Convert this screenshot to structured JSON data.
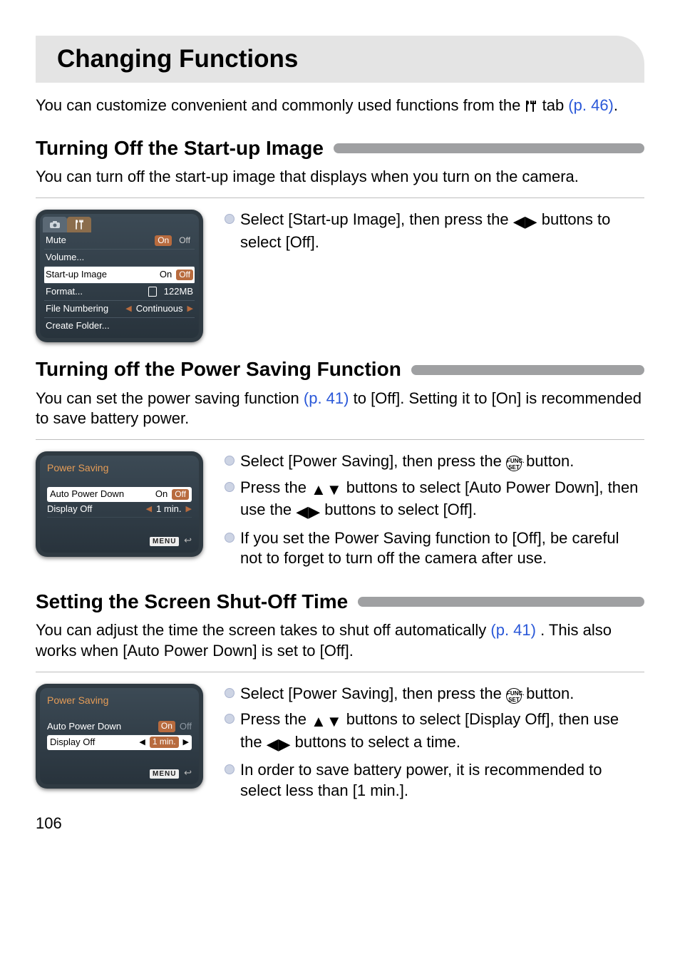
{
  "page_number": "106",
  "title": "Changing Functions",
  "intro": {
    "line1_pre": "You can customize convenient and commonly used functions from the ",
    "line1_post": " tab ",
    "ref1": "(p. 46)",
    "period": "."
  },
  "icons": {
    "tools": "tools-icon",
    "left_right": "◀▶",
    "up_down": "▲▼",
    "func_top": "FUNC.",
    "func_bot": "SET",
    "menu_label": "MENU",
    "back": "↩"
  },
  "sectionA": {
    "title": "Turning Off the Start-up Image",
    "body": "You can turn off the start-up image that displays when you turn on the camera.",
    "bullet1_pre": "Select [Start-up Image], then press the ",
    "bullet1_post": " buttons to select [Off].",
    "shot": {
      "tab_camera": "camera",
      "tab_tools": "tools",
      "rows": {
        "mute": {
          "label": "Mute",
          "on": "On",
          "off": "Off"
        },
        "volume": {
          "label": "Volume..."
        },
        "startup": {
          "label": "Start-up Image",
          "on": "On",
          "off": "Off"
        },
        "format": {
          "label": "Format...",
          "val": "122MB"
        },
        "filenum": {
          "label": "File Numbering",
          "val": "Continuous"
        },
        "create": {
          "label": "Create Folder..."
        }
      }
    }
  },
  "sectionB": {
    "title": "Turning off the Power Saving Function",
    "body_pre": "You can set the power saving function ",
    "body_ref": "(p. 41)",
    "body_post": " to [Off]. Setting it to [On] is recommended to save battery power.",
    "b1_pre": "Select [Power Saving], then press the ",
    "b1_post": " button.",
    "b2_pre": "Press the ",
    "b2_mid": " buttons to select [Auto Power Down], then use the ",
    "b2_post": " buttons to select [Off].",
    "b3": "If you set the Power Saving function to [Off], be careful not to forget to turn off the camera after use.",
    "shot": {
      "title": "Power Saving",
      "apd": {
        "label": "Auto Power Down",
        "on": "On",
        "off": "Off"
      },
      "disp": {
        "label": "Display Off",
        "val": "1 min."
      }
    }
  },
  "sectionC": {
    "title": "Setting the Screen Shut-Off Time",
    "body_pre": "You can adjust the time the screen takes to shut off automatically ",
    "body_ref": "(p. 41)",
    "body_post": ". This also works when [Auto Power Down] is set to [Off].",
    "b1_pre": "Select [Power Saving], then press the ",
    "b1_post": " button.",
    "b2_pre": "Press the ",
    "b2_mid": " buttons to select [Display Off], then use the ",
    "b2_post": " buttons to select a time.",
    "b3": "In order to save battery power, it is recommended to select less than [1 min.].",
    "shot": {
      "title": "Power Saving",
      "apd": {
        "label": "Auto Power Down",
        "on": "On",
        "off": "Off"
      },
      "disp": {
        "label": "Display Off",
        "val": "1 min."
      }
    }
  }
}
